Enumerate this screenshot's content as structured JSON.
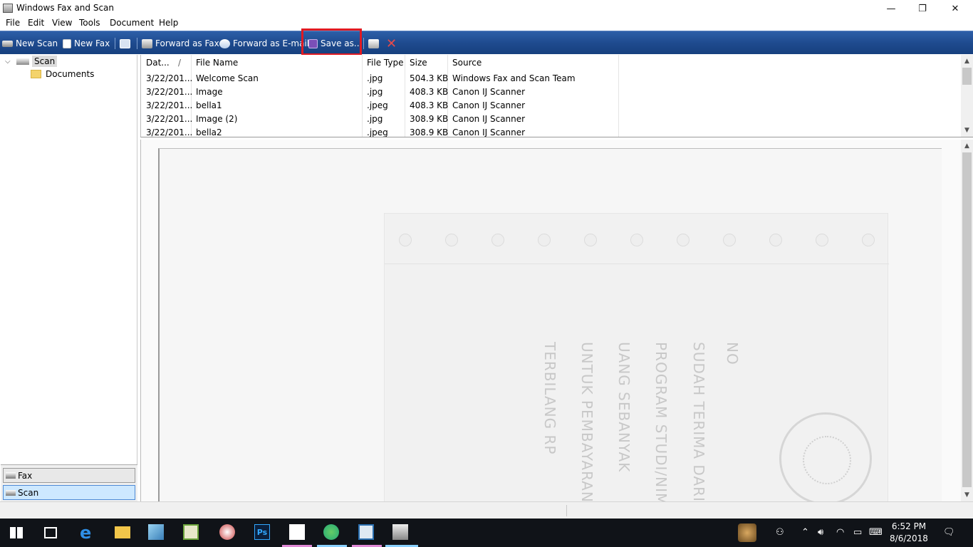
{
  "window": {
    "title": "Windows Fax and Scan",
    "minimize_glyph": "—",
    "restore_glyph": "❐",
    "close_glyph": "✕"
  },
  "menu": [
    "File",
    "Edit",
    "View",
    "Tools",
    "Document",
    "Help"
  ],
  "toolbar": {
    "new_scan": "New Scan",
    "new_fax": "New Fax",
    "forward_fax": "Forward as Fax",
    "forward_email": "Forward as E-mail",
    "save_as": "Save as...",
    "highlight_color": "#e01a22"
  },
  "tree": {
    "root": "Scan",
    "child": "Documents",
    "expand_glyph": "⌵"
  },
  "nav_tabs": {
    "fax": "Fax",
    "scan": "Scan",
    "active": "Scan"
  },
  "list": {
    "columns": {
      "date": "Dat...",
      "sort_glyph": "/",
      "file_name": "File Name",
      "file_type": "File Type",
      "size": "Size",
      "source": "Source"
    },
    "rows": [
      {
        "date": "3/22/201...",
        "name": "Welcome Scan",
        "type": ".jpg",
        "size": "504.3 KB",
        "source": "Windows Fax and Scan Team"
      },
      {
        "date": "3/22/201...",
        "name": "Image",
        "type": ".jpg",
        "size": "408.3 KB",
        "source": "Canon IJ Scanner"
      },
      {
        "date": "3/22/201...",
        "name": "bella1",
        "type": ".jpeg",
        "size": "408.3 KB",
        "source": "Canon IJ Scanner"
      },
      {
        "date": "3/22/201...",
        "name": "Image (2)",
        "type": ".jpg",
        "size": "308.9 KB",
        "source": "Canon IJ Scanner"
      },
      {
        "date": "3/22/201...",
        "name": "bella2",
        "type": ".jpeg",
        "size": "308.9 KB",
        "source": "Canon IJ Scanner"
      }
    ]
  },
  "scroll_glyphs": {
    "up": "▲",
    "down": "▼"
  },
  "preview": {
    "lines": [
      "NO",
      "SUDAH TERIMA DARI",
      "PROGRAM STUDI/NIM",
      "UANG SEBANYAK",
      "UNTUK PEMBAYARAN",
      "TERBILANG RP"
    ]
  },
  "taskbar": {
    "time": "6:52 PM",
    "date": "8/6/2018",
    "ps_label": "Ps",
    "edge_glyph": "e"
  }
}
